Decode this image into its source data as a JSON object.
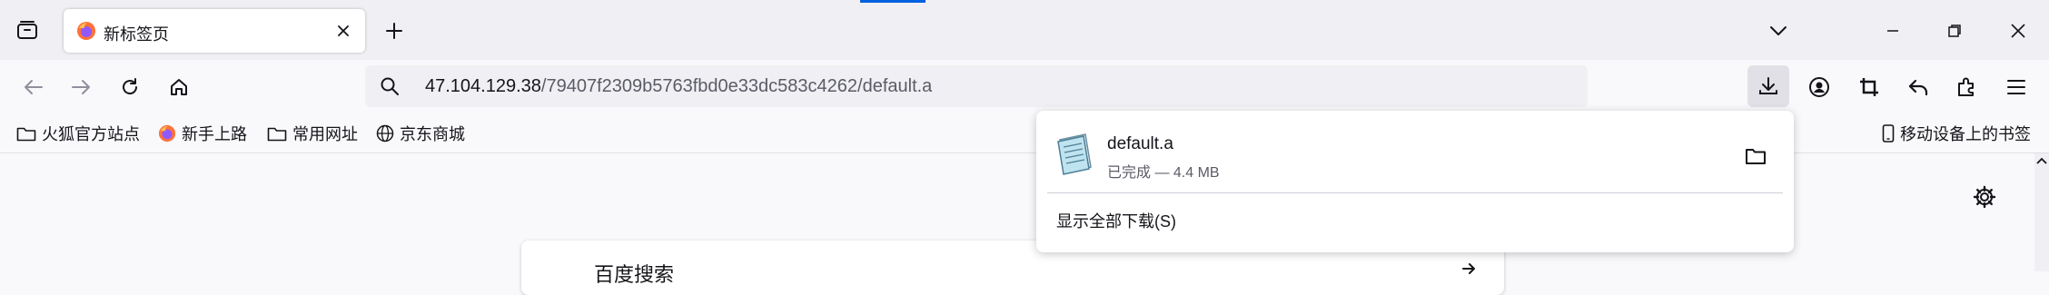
{
  "tab": {
    "title": "新标签页",
    "favicon": "firefox-icon"
  },
  "url": {
    "host": "47.104.129.38",
    "path": "/79407f2309b5763fbd0e33dc583c4262/default.a"
  },
  "bookmarks": {
    "items": [
      {
        "label": "火狐官方站点",
        "icon": "folder-icon"
      },
      {
        "label": "新手上路",
        "icon": "firefox-icon"
      },
      {
        "label": "常用网址",
        "icon": "folder-icon"
      },
      {
        "label": "京东商城",
        "icon": "globe-icon"
      }
    ],
    "mobile": {
      "label": "移动设备上的书签",
      "icon": "mobile-icon"
    }
  },
  "downloads": {
    "filename": "default.a",
    "status": "已完成 — 4.4 MB",
    "show_all": "显示全部下载(S)"
  },
  "search": {
    "placeholder": "百度搜索"
  },
  "colors": {
    "accent": "#0061e0",
    "toolbar": "#f9f9fb",
    "tabstrip": "#f0f0f4"
  }
}
